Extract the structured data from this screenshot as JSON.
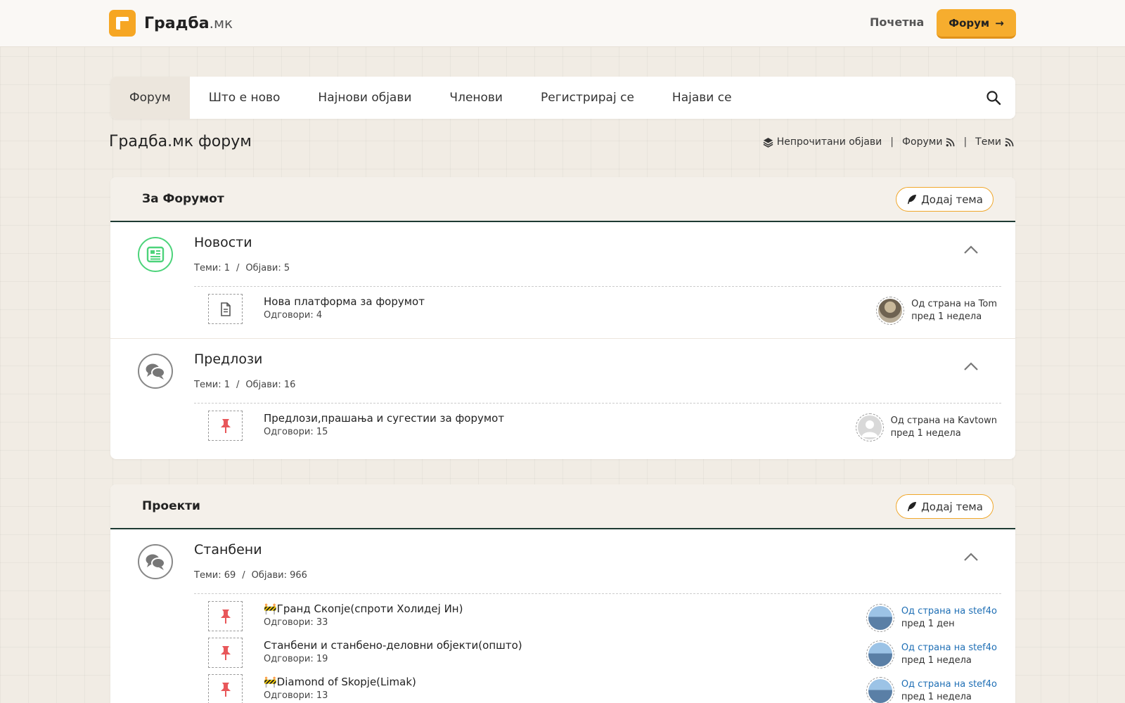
{
  "brand": {
    "name": "Градба",
    "suffix": ".мк"
  },
  "top": {
    "home": "Почетна",
    "forum_button": "Форум",
    "forum_arrow": "→"
  },
  "nav": {
    "items": [
      "Форум",
      "Што е ново",
      "Најнови објави",
      "Членови",
      "Регистрирај се",
      "Најави се"
    ]
  },
  "page_title": "Градба.мк форум",
  "quicklinks": {
    "unread": "Непрочитани објави",
    "forums": "Форуми",
    "topics": "Теми",
    "sep": "|"
  },
  "colors": {
    "accent": "#f6ad2e",
    "header_rule": "#1e3b33",
    "pin": "#e8575a",
    "link": "#1f6fb5",
    "news_green": "#4cd37a"
  },
  "categories": [
    {
      "title": "За Форумот",
      "add_topic": "Додај тема",
      "forums": [
        {
          "title": "Новости",
          "icon": "newspaper-icon",
          "stats": {
            "topics": "Теми: 1",
            "sep": "/",
            "posts": "Објави: 5"
          },
          "threads": [
            {
              "icon": "document-icon",
              "title": "Нова платформа за форумот",
              "replies": "Одговори: 4",
              "by": "Од страна на Tom",
              "when": "пред 1 недела"
            }
          ]
        },
        {
          "title": "Предлози",
          "icon": "chat-bubbles-icon",
          "stats": {
            "topics": "Теми: 1",
            "sep": "/",
            "posts": "Објави: 16"
          },
          "threads": [
            {
              "icon": "pin-icon",
              "title": "Предлози,прашања и сугестии за форумот",
              "replies": "Одговори: 15",
              "by": "Од страна на Kavtown",
              "when": "пред 1 недела"
            }
          ]
        }
      ]
    },
    {
      "title": "Проекти",
      "add_topic": "Додај тема",
      "forums": [
        {
          "title": "Станбени",
          "icon": "chat-bubbles-icon",
          "stats": {
            "topics": "Теми: 69",
            "sep": "/",
            "posts": "Објави: 966"
          },
          "threads": [
            {
              "icon": "pin-icon",
              "title": "🚧Гранд Скопје(спроти Холидеј Ин)",
              "replies": "Одговори: 33",
              "by": "Од страна на stef4o",
              "when": "пред 1 ден"
            },
            {
              "icon": "pin-icon",
              "title": "Станбени и станбено-деловни објекти(општо)",
              "replies": "Одговори: 19",
              "by": "Од страна на stef4o",
              "when": "пред 1 недела"
            },
            {
              "icon": "pin-icon",
              "title": "🚧Diamond of Skopje(Limak)",
              "replies": "Одговори: 13",
              "by": "Од страна на stef4o",
              "when": "пред 1 недела"
            }
          ]
        }
      ]
    }
  ]
}
